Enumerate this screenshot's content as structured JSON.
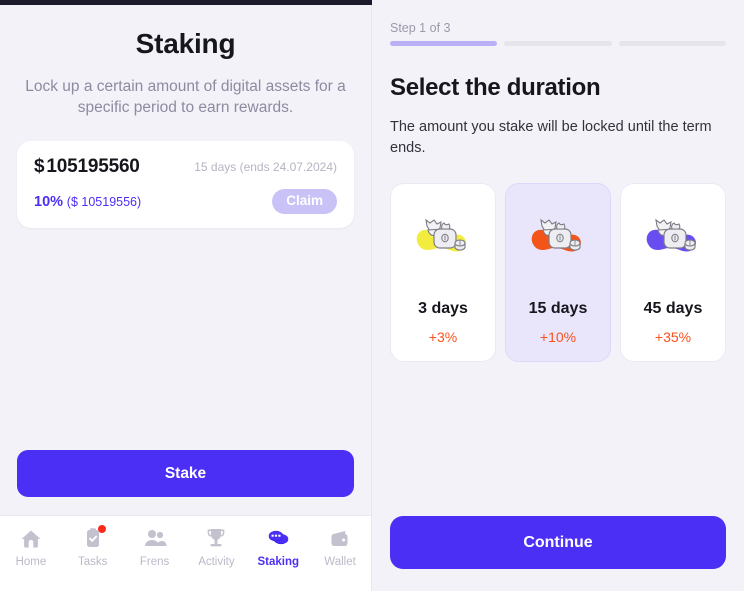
{
  "left": {
    "title": "Staking",
    "subtitle": "Lock up a certain amount of digital assets for a specific period to earn rewards.",
    "stake_card": {
      "currency_symbol": "$",
      "amount": "105195560",
      "term": "15 days (ends 24.07.2024)",
      "yield_percent": "10%",
      "yield_amount": "($ 10519556)",
      "claim_label": "Claim"
    },
    "stake_button_label": "Stake"
  },
  "nav": {
    "items": [
      {
        "label": "Home",
        "icon": "home-icon",
        "active": false,
        "badge": false
      },
      {
        "label": "Tasks",
        "icon": "clipboard-check-icon",
        "active": false,
        "badge": true
      },
      {
        "label": "Frens",
        "icon": "people-icon",
        "active": false,
        "badge": false
      },
      {
        "label": "Activity",
        "icon": "trophy-icon",
        "active": false,
        "badge": false
      },
      {
        "label": "Staking",
        "icon": "coins-icon",
        "active": true,
        "badge": false
      },
      {
        "label": "Wallet",
        "icon": "wallet-icon",
        "active": false,
        "badge": false
      }
    ]
  },
  "right": {
    "step_label": "Step 1 of 3",
    "step_total": 3,
    "step_current": 1,
    "heading": "Select the duration",
    "description": "The amount you stake will be locked until the term ends.",
    "durations": [
      {
        "days_label": "3 days",
        "bonus": "+3%",
        "swirl_color": "#f2ec3f",
        "selected": false,
        "icon": "money-bag-icon"
      },
      {
        "days_label": "15 days",
        "bonus": "+10%",
        "swirl_color": "#f2541a",
        "selected": true,
        "icon": "money-bag-icon"
      },
      {
        "days_label": "45 days",
        "bonus": "+35%",
        "swirl_color": "#6a4df0",
        "selected": false,
        "icon": "money-bag-icon"
      }
    ],
    "continue_label": "Continue"
  },
  "colors": {
    "accent": "#4b2ff5",
    "accent_soft": "#c9c2f7",
    "bonus": "#f9521f",
    "background": "#f3f2f8",
    "surface": "#ffffff",
    "muted_text": "#8d8ba0",
    "badge": "#fa2a1e"
  }
}
